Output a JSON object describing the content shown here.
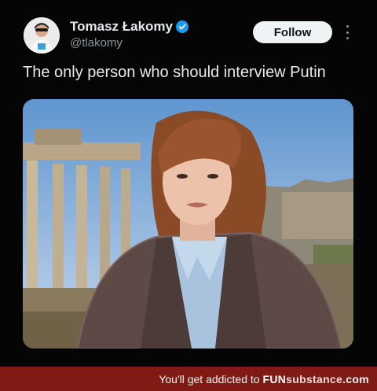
{
  "author": {
    "name": "Tomasz Łakomy",
    "handle": "@tlakomy",
    "verified": true,
    "verified_color": "#1d9bf0"
  },
  "actions": {
    "follow_label": "Follow",
    "more_icon": "more-vertical-icon"
  },
  "tweet": {
    "text": "The only person who should interview Putin"
  },
  "media": {
    "kind": "photo"
  },
  "footer": {
    "prefix": "You'll get addicted to",
    "brand_a": "FUN",
    "brand_b": "substance",
    "brand_c": ".com",
    "background": "#7f1a14"
  }
}
